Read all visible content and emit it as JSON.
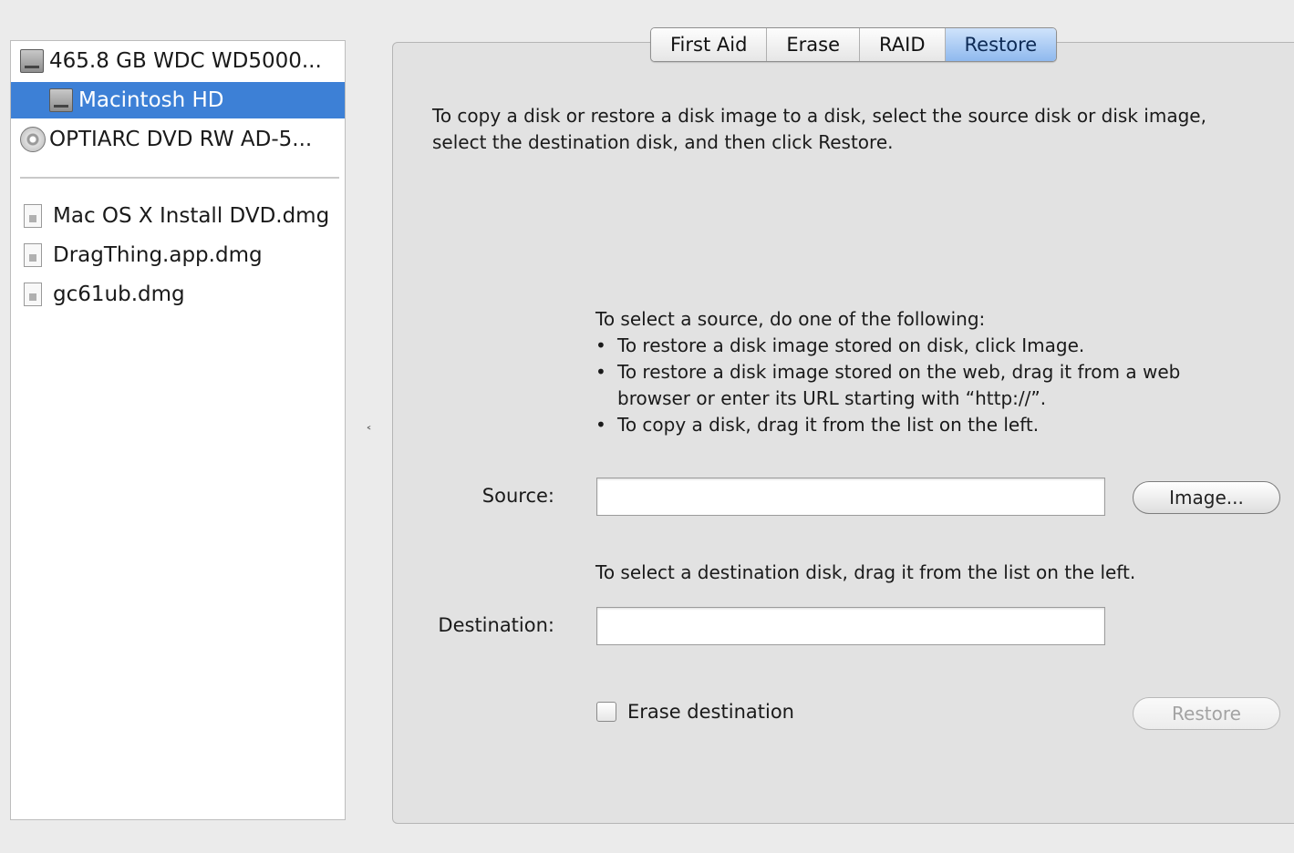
{
  "sidebar": {
    "disks": [
      {
        "label": "465.8 GB WDC WD5000...",
        "icon": "hard-disk-icon"
      },
      {
        "label": "Macintosh HD",
        "icon": "volume-icon",
        "selected": true
      },
      {
        "label": "OPTIARC DVD RW AD-5...",
        "icon": "dvd-drive-icon"
      }
    ],
    "images": [
      {
        "label": "Mac OS X Install DVD.dmg",
        "icon": "disk-image-icon"
      },
      {
        "label": "DragThing.app.dmg",
        "icon": "disk-image-icon"
      },
      {
        "label": "gc61ub.dmg",
        "icon": "disk-image-icon"
      }
    ]
  },
  "tabs": [
    {
      "label": "First Aid"
    },
    {
      "label": "Erase"
    },
    {
      "label": "RAID"
    },
    {
      "label": "Restore",
      "active": true
    }
  ],
  "restore": {
    "intro_line1": "To copy a disk or restore a disk image to a disk, select the source disk or disk image,",
    "intro_line2": "select the destination disk, and then click Restore.",
    "source_heading": "To select a source, do one of the following:",
    "bullet1": "To restore a disk image stored on disk, click Image.",
    "bullet2_line1": "To restore a disk image stored on the web, drag it from a web",
    "bullet2_line2": "browser or enter its URL starting with “http://”.",
    "bullet3": "To copy a disk, drag it from the list on the left.",
    "source_label": "Source:",
    "source_value": "",
    "image_button": "Image...",
    "destination_hint": "To select a destination disk, drag it from the list on the left.",
    "destination_label": "Destination:",
    "destination_value": "",
    "erase_destination_label": "Erase destination",
    "erase_destination_checked": false,
    "restore_button": "Restore"
  },
  "colors": {
    "selection": "#3d80d6",
    "active_tab": "#8fb9ee"
  }
}
